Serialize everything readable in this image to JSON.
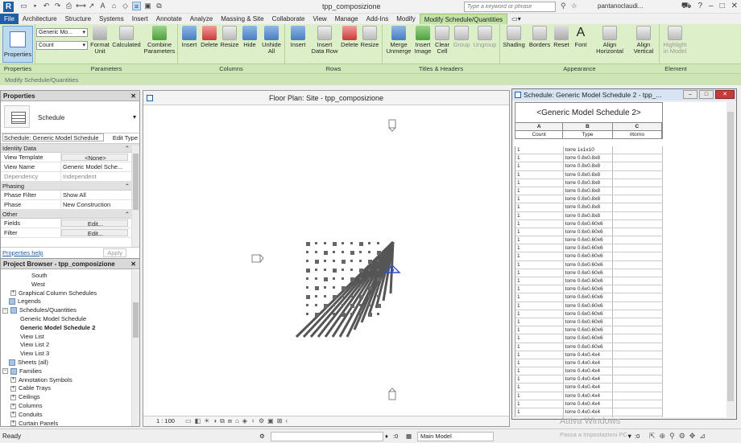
{
  "app": {
    "title": "tpp_composizione",
    "search_placeholder": "Type a keyword or phrase",
    "user": "pantanoclaudi...",
    "logo": "R"
  },
  "tabs": [
    "File",
    "Architecture",
    "Structure",
    "Systems",
    "Insert",
    "Annotate",
    "Analyze",
    "Massing & Site",
    "Collaborate",
    "View",
    "Manage",
    "Add-Ins",
    "Modify",
    "Modify Schedule/Quantities"
  ],
  "active_tab_index": 13,
  "ribbon": {
    "properties_button": "Properties",
    "combo_family": "Generic Mo...",
    "combo_param": "Count",
    "parameters_buttons": [
      "Format Unit",
      "Calculated",
      "Combine Parameters"
    ],
    "columns_buttons": [
      "Insert",
      "Delete",
      "Resize",
      "Hide",
      "Unhide All"
    ],
    "rows_buttons": [
      "Insert",
      "Insert Data Row",
      "Delete",
      "Resize"
    ],
    "titles_buttons": [
      "Merge Unmerge",
      "Insert Image",
      "Clear Cell",
      "Group",
      "Ungroup"
    ],
    "appearance_buttons": [
      "Shading",
      "Borders",
      "Reset",
      "Font",
      "Align Horizontal",
      "Align Vertical"
    ],
    "element_buttons": [
      "Highlight in Model"
    ],
    "panels": [
      "Properties",
      "Parameters",
      "Columns",
      "Rows",
      "Titles & Headers",
      "Appearance",
      "Element"
    ],
    "context_label": "Modify Schedule/Quantities"
  },
  "properties": {
    "header": "Properties",
    "type_label": "Schedule",
    "instance_selector": "Schedule: Generic Model Schedule",
    "edit_type": "Edit Type",
    "sections": {
      "identity": "Identity Data",
      "phasing": "Phasing",
      "other": "Other"
    },
    "rows": {
      "view_template": {
        "k": "View Template",
        "v": "<None>"
      },
      "view_name": {
        "k": "View Name",
        "v": "Generic Model Sche..."
      },
      "dependency": {
        "k": "Dependency",
        "v": "Independent"
      },
      "phase_filter": {
        "k": "Phase Filter",
        "v": "Show All"
      },
      "phase": {
        "k": "Phase",
        "v": "New Construction"
      },
      "fields": {
        "k": "Fields",
        "v": "Edit..."
      },
      "filter": {
        "k": "Filter",
        "v": "Edit..."
      }
    },
    "help_link": "Properties help",
    "apply": "Apply"
  },
  "browser": {
    "header": "Project Browser - tpp_composizione",
    "items": [
      {
        "label": "South",
        "indent": 38,
        "type": "leaf"
      },
      {
        "label": "West",
        "indent": 38,
        "type": "leaf"
      },
      {
        "label": "Graphical Column Schedules",
        "indent": 12,
        "type": "plus"
      },
      {
        "label": "Legends",
        "indent": 10,
        "type": "icon"
      },
      {
        "label": "Schedules/Quantities",
        "indent": 2,
        "type": "minus"
      },
      {
        "label": "Generic Model Schedule",
        "indent": 24,
        "type": "leaf"
      },
      {
        "label": "Generic Model Schedule 2",
        "indent": 24,
        "type": "leaf-bold"
      },
      {
        "label": "View List",
        "indent": 24,
        "type": "leaf"
      },
      {
        "label": "View List 2",
        "indent": 24,
        "type": "leaf"
      },
      {
        "label": "View List 3",
        "indent": 24,
        "type": "leaf"
      },
      {
        "label": "Sheets (all)",
        "indent": 10,
        "type": "icon"
      },
      {
        "label": "Families",
        "indent": 2,
        "type": "minus"
      },
      {
        "label": "Annotation Symbols",
        "indent": 12,
        "type": "plus"
      },
      {
        "label": "Cable Trays",
        "indent": 12,
        "type": "plus"
      },
      {
        "label": "Ceilings",
        "indent": 12,
        "type": "plus"
      },
      {
        "label": "Columns",
        "indent": 12,
        "type": "plus"
      },
      {
        "label": "Conduits",
        "indent": 12,
        "type": "plus"
      },
      {
        "label": "Curtain Panels",
        "indent": 12,
        "type": "plus"
      }
    ]
  },
  "floorplan": {
    "title": "Floor Plan: Site - tpp_composizione",
    "scale": "1 : 100"
  },
  "schedule": {
    "window_title": "Schedule: Generic Model Schedule 2 - tpp_...",
    "table_title": "<Generic Model Schedule 2>",
    "col_letters": [
      "A",
      "B",
      "C"
    ],
    "col_labels": [
      "Count",
      "Type",
      "ritorno"
    ],
    "rows": [
      [
        "1",
        "torre 1x1x10",
        ""
      ],
      [
        "1",
        "torre 0.8x0.8x8",
        ""
      ],
      [
        "1",
        "torre 0.8x0.8x8",
        ""
      ],
      [
        "1",
        "torre 0.8x0.8x8",
        ""
      ],
      [
        "1",
        "torre 0.8x0.8x8",
        ""
      ],
      [
        "1",
        "torre 0.8x0.8x8",
        ""
      ],
      [
        "1",
        "torre 0.8x0.8x8",
        ""
      ],
      [
        "1",
        "torre 0.8x0.8x8",
        ""
      ],
      [
        "1",
        "torre 0.8x0.8x8",
        ""
      ],
      [
        "1",
        "torre 0.6x0.60x6",
        ""
      ],
      [
        "1",
        "torre 0.6x0.60x6",
        ""
      ],
      [
        "1",
        "torre 0.6x0.60x6",
        ""
      ],
      [
        "1",
        "torre 0.6x0.60x6",
        ""
      ],
      [
        "1",
        "torre 0.6x0.60x6",
        ""
      ],
      [
        "1",
        "torre 0.6x0.60x6",
        ""
      ],
      [
        "1",
        "torre 0.6x0.60x6",
        ""
      ],
      [
        "1",
        "torre 0.6x0.60x6",
        ""
      ],
      [
        "1",
        "torre 0.6x0.60x6",
        ""
      ],
      [
        "1",
        "torre 0.6x0.60x6",
        ""
      ],
      [
        "1",
        "torre 0.6x0.60x6",
        ""
      ],
      [
        "1",
        "torre 0.6x0.60x6",
        ""
      ],
      [
        "1",
        "torre 0.6x0.60x6",
        ""
      ],
      [
        "1",
        "torre 0.6x0.60x6",
        ""
      ],
      [
        "1",
        "torre 0.6x0.60x6",
        ""
      ],
      [
        "1",
        "torre 0.6x0.60x6",
        ""
      ],
      [
        "1",
        "torre 0.4x0.4x4",
        ""
      ],
      [
        "1",
        "torre 0.4x0.4x4",
        ""
      ],
      [
        "1",
        "torre 0.4x0.4x4",
        ""
      ],
      [
        "1",
        "torre 0.4x0.4x4",
        ""
      ],
      [
        "1",
        "torre 0.4x0.4x4",
        ""
      ],
      [
        "1",
        "torre 0.4x0.4x4",
        ""
      ],
      [
        "1",
        "torre 0.4x0.4x4",
        ""
      ],
      [
        "1",
        "torre 0.4x0.4x4",
        ""
      ],
      [
        "1",
        "torre 0.4x0.4x4",
        ""
      ]
    ]
  },
  "statusbar": {
    "ready": "Ready",
    "num1": ":0",
    "model": "Main Model",
    "num2": ":0",
    "watermark": "Attiva Windows",
    "watermark2": "Passa a Impostazioni PC"
  },
  "colors": {
    "accent": "#1f5fa8",
    "ribbon": "#dcefc8",
    "active_tab": "#c4e3a6"
  }
}
